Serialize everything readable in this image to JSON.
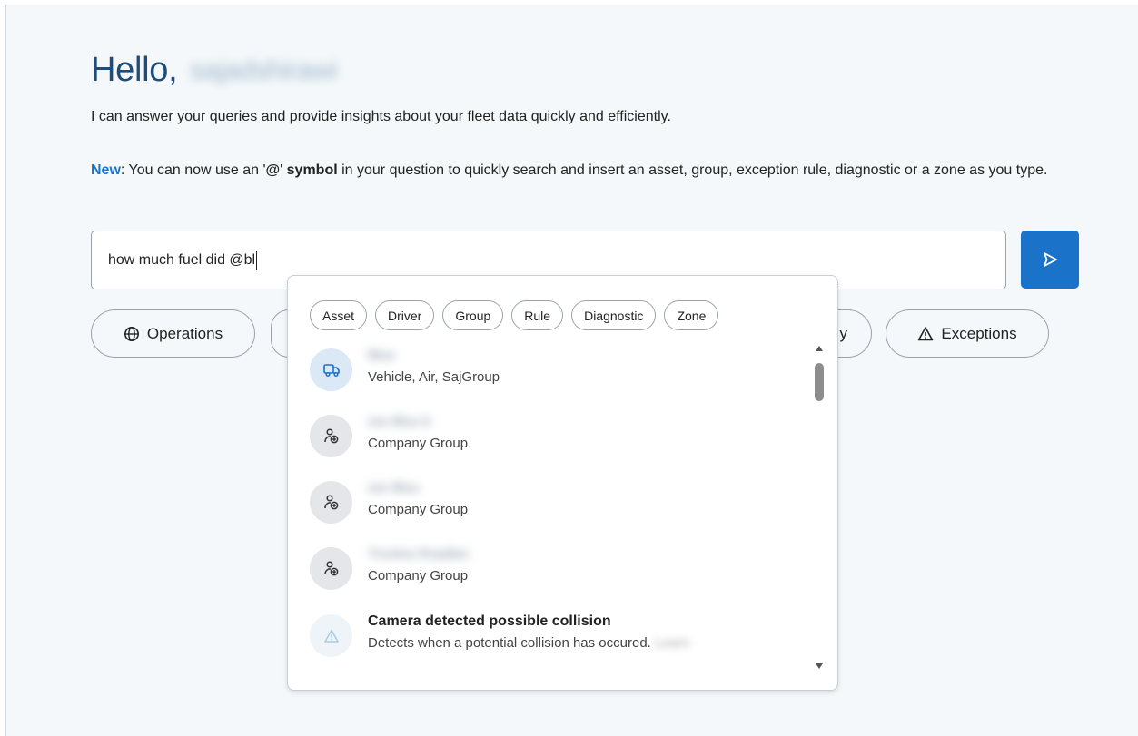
{
  "header": {
    "greeting": "Hello,",
    "user_name": "sajadshirawi"
  },
  "intro": "I can answer your queries and provide insights about your fleet data quickly and efficiently.",
  "new_note": {
    "new_label": "New",
    "part1": ": You can now use an '",
    "symbol": "@",
    "part2": "' ",
    "symbol_word": "symbol",
    "part3": " in your question to quickly search and insert an asset, group, exception rule, diagnostic or a zone as you type."
  },
  "query": {
    "value": "how much fuel did @bl"
  },
  "chips": {
    "operations": "Operations",
    "partial_right": "y",
    "exceptions": "Exceptions"
  },
  "dropdown": {
    "filters": [
      "Asset",
      "Driver",
      "Group",
      "Rule",
      "Diagnostic",
      "Zone"
    ],
    "items": [
      {
        "type": "vehicle",
        "title": "Bluu",
        "subtitle": "Vehicle, Air, SajGroup"
      },
      {
        "type": "group",
        "title": "sss Bluu b",
        "subtitle": "Company Group"
      },
      {
        "type": "group",
        "title": "sss Bluu",
        "subtitle": "Company Group"
      },
      {
        "type": "group",
        "title": "Truckss Roadies",
        "subtitle": "Company Group"
      },
      {
        "type": "rule",
        "title": "Camera detected possible collision",
        "subtitle": "Detects when a potential collision has occured.",
        "subtitle_tail": "Learn"
      }
    ]
  },
  "colors": {
    "accent": "#1a73c8",
    "title": "#1f4d7a",
    "panel_bg": "#f4f8fa"
  }
}
